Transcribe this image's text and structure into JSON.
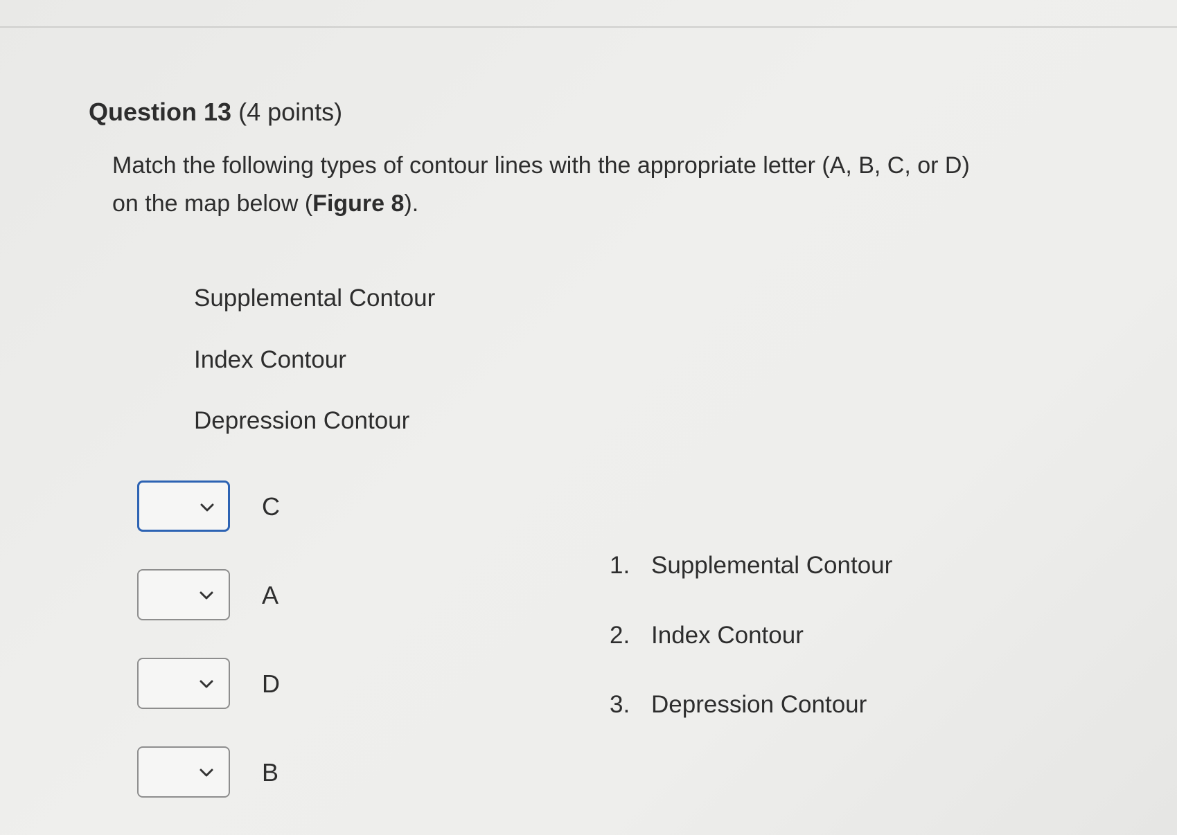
{
  "question": {
    "number_label": "Question 13",
    "points_label": "(4 points)",
    "prompt_line1": "Match the following types of contour lines with the appropriate letter (A, B, C, or D)",
    "prompt_line2_before": "on the map below (",
    "prompt_line2_bold": "Figure 8",
    "prompt_line2_after": ")."
  },
  "terms": [
    {
      "label": "Supplemental Contour"
    },
    {
      "label": "Index Contour"
    },
    {
      "label": "Depression Contour"
    }
  ],
  "matches": [
    {
      "selected": "",
      "letter": "C",
      "focused": true
    },
    {
      "selected": "",
      "letter": "A",
      "focused": false
    },
    {
      "selected": "",
      "letter": "D",
      "focused": false
    },
    {
      "selected": "",
      "letter": "B",
      "focused": false
    }
  ],
  "answer_options": [
    {
      "number": "1.",
      "label": "Supplemental Contour"
    },
    {
      "number": "2.",
      "label": "Index Contour"
    },
    {
      "number": "3.",
      "label": "Depression Contour"
    }
  ],
  "icons": {
    "dropdown": "chevron-down-icon"
  },
  "colors": {
    "focus_border": "#2d63b3",
    "default_border": "#8e8e8e",
    "text": "#2d2d2d"
  }
}
